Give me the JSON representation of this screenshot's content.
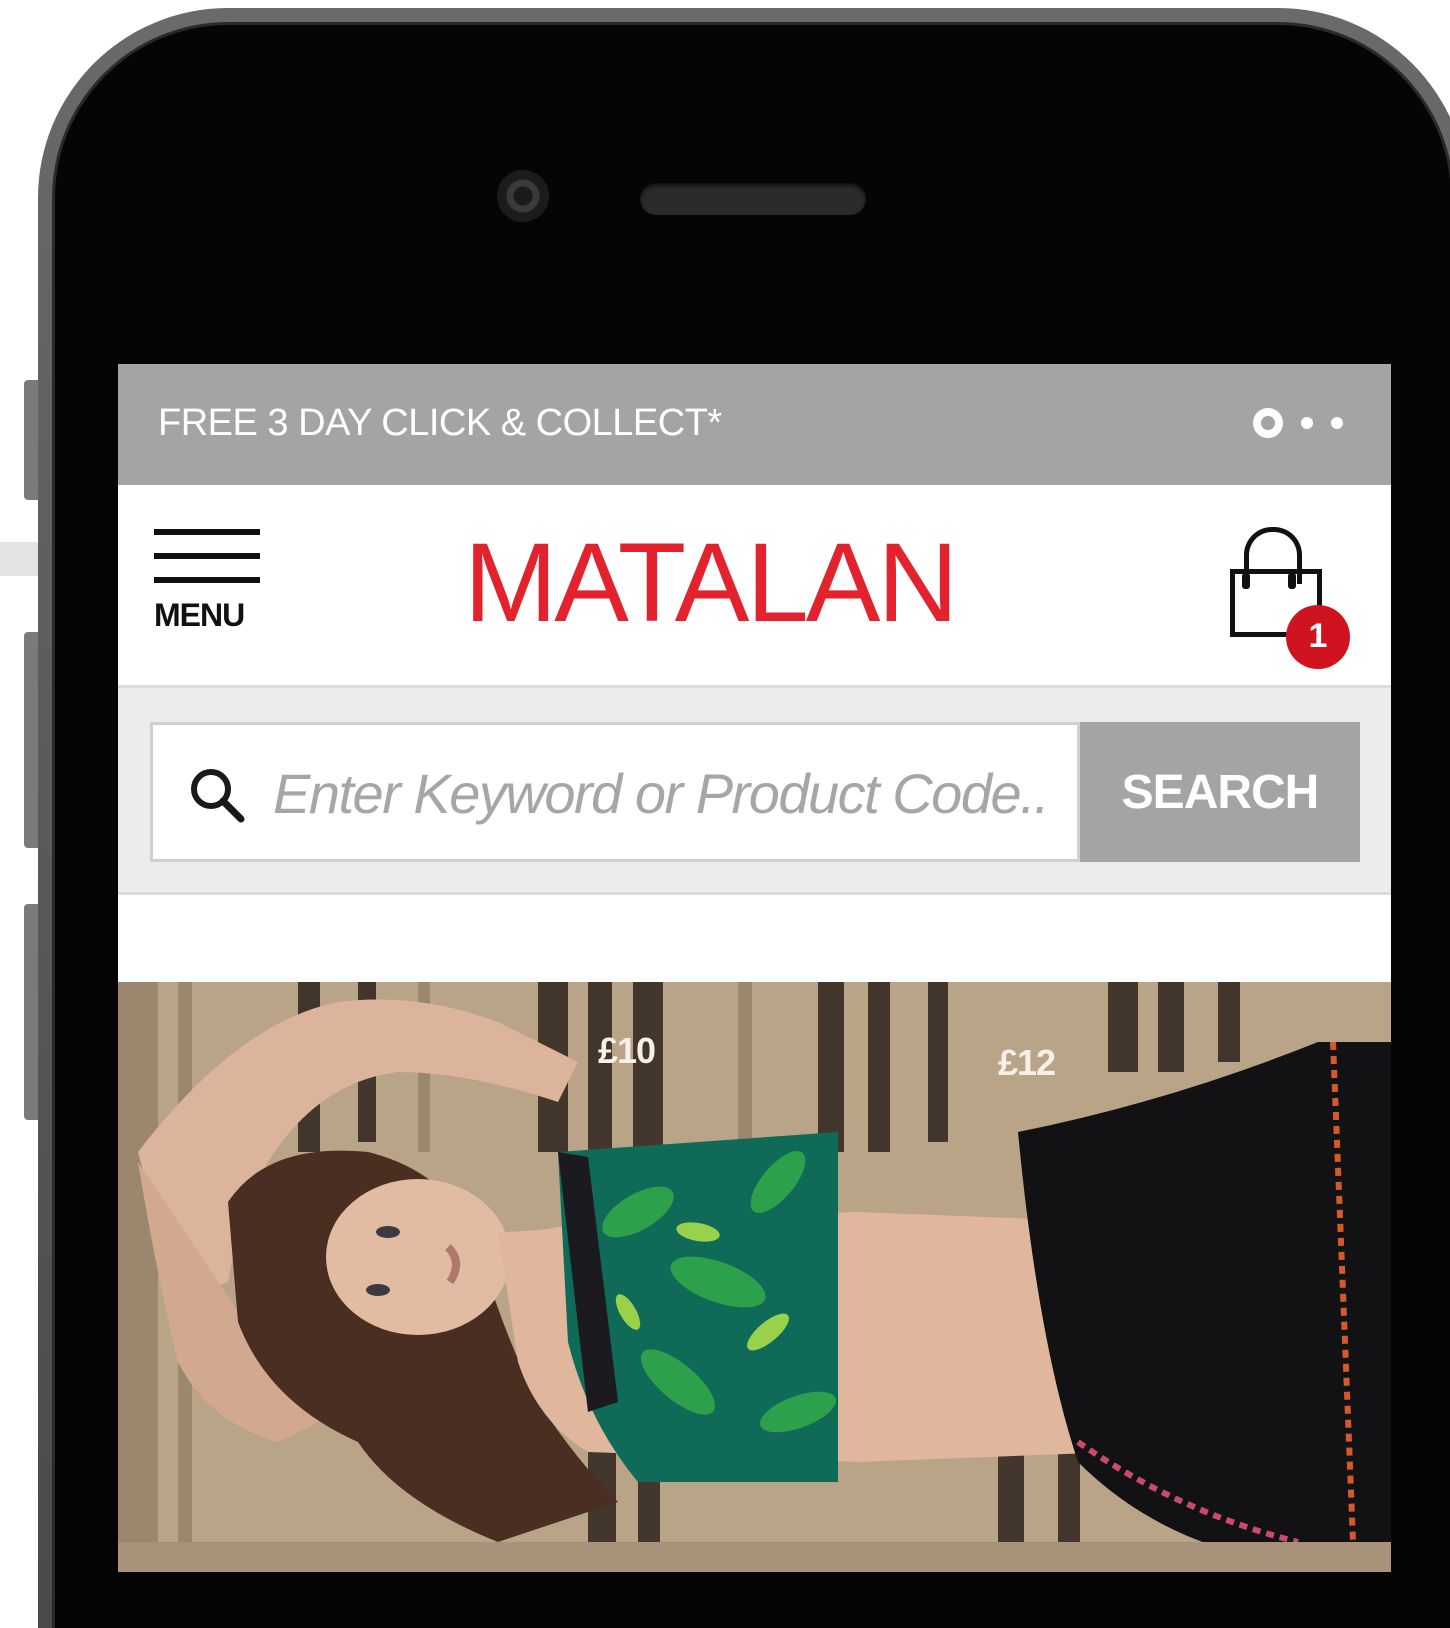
{
  "promo": {
    "text": "FREE 3 DAY CLICK & COLLECT*"
  },
  "header": {
    "menu_label": "MENU",
    "logo": "MATALAN",
    "bag_count": "1"
  },
  "search": {
    "placeholder": "Enter Keyword or Product Code..",
    "button_label": "SEARCH"
  },
  "hero": {
    "prices": [
      "£10",
      "£12"
    ]
  },
  "colors": {
    "brand_red": "#e2232d",
    "promo_bar": "#a4a4a4",
    "badge": "#d0141f",
    "search_button": "#a4a4a4"
  },
  "icons": [
    "menu-icon",
    "bag-icon",
    "search-icon",
    "carousel-dots-icon"
  ]
}
